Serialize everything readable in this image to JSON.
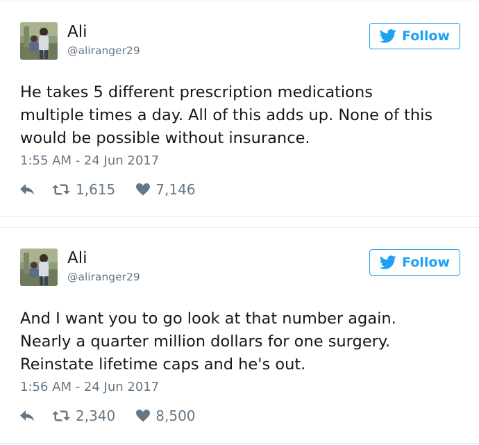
{
  "tweets": [
    {
      "name": "Ali",
      "handle": "@aliranger29",
      "follow_label": "Follow",
      "text": "He takes 5 different prescription medications\nmultiple times a day. All of this adds up. None of this\nwould be possible without insurance.",
      "timestamp": "1:55 AM - 24 Jun 2017",
      "retweets": "1,615",
      "likes": "7,146"
    },
    {
      "name": "Ali",
      "handle": "@aliranger29",
      "follow_label": "Follow",
      "text": "And I want you to go look at that number again.\nNearly a quarter million dollars for one surgery.\nReinstate lifetime caps and he's out.",
      "timestamp": "1:56 AM - 24 Jun 2017",
      "retweets": "2,340",
      "likes": "8,500"
    }
  ],
  "colors": {
    "accent": "#1da1f2",
    "muted": "#657786",
    "text": "#14171a",
    "border": "#e6ecf0"
  },
  "icons": [
    "avatar-photo",
    "twitter-bird-icon",
    "reply-icon",
    "retweet-icon",
    "heart-icon"
  ]
}
